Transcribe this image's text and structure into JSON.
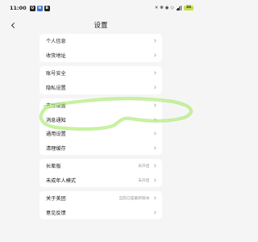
{
  "status_bar": {
    "time": "11:00",
    "apps": [
      "Q",
      "N",
      "B"
    ],
    "indicators": "✕ ❋ ◉ ◇",
    "battery": "36"
  },
  "header": {
    "title": "设置",
    "back_icon": "chevron-left-icon"
  },
  "groups": [
    {
      "items": [
        {
          "label": "个人信息"
        },
        {
          "label": "收货地址"
        }
      ]
    },
    {
      "items": [
        {
          "label": "账号安全"
        },
        {
          "label": "隐私设置"
        }
      ]
    },
    {
      "items": [
        {
          "label": "支付设置"
        },
        {
          "label": "消息通知"
        },
        {
          "label": "通用设置"
        },
        {
          "label": "清理缓存"
        }
      ]
    },
    {
      "items": [
        {
          "label": "长辈版",
          "value": "未开启"
        },
        {
          "label": "未成年人模式",
          "value": "未开启"
        }
      ]
    },
    {
      "items": [
        {
          "label": "关于美团",
          "value": "当前已是最新版本"
        },
        {
          "label": "意见反馈"
        }
      ]
    }
  ],
  "annotation": {
    "color": "#8fe04a",
    "shape": "green-highlight-scribble"
  }
}
